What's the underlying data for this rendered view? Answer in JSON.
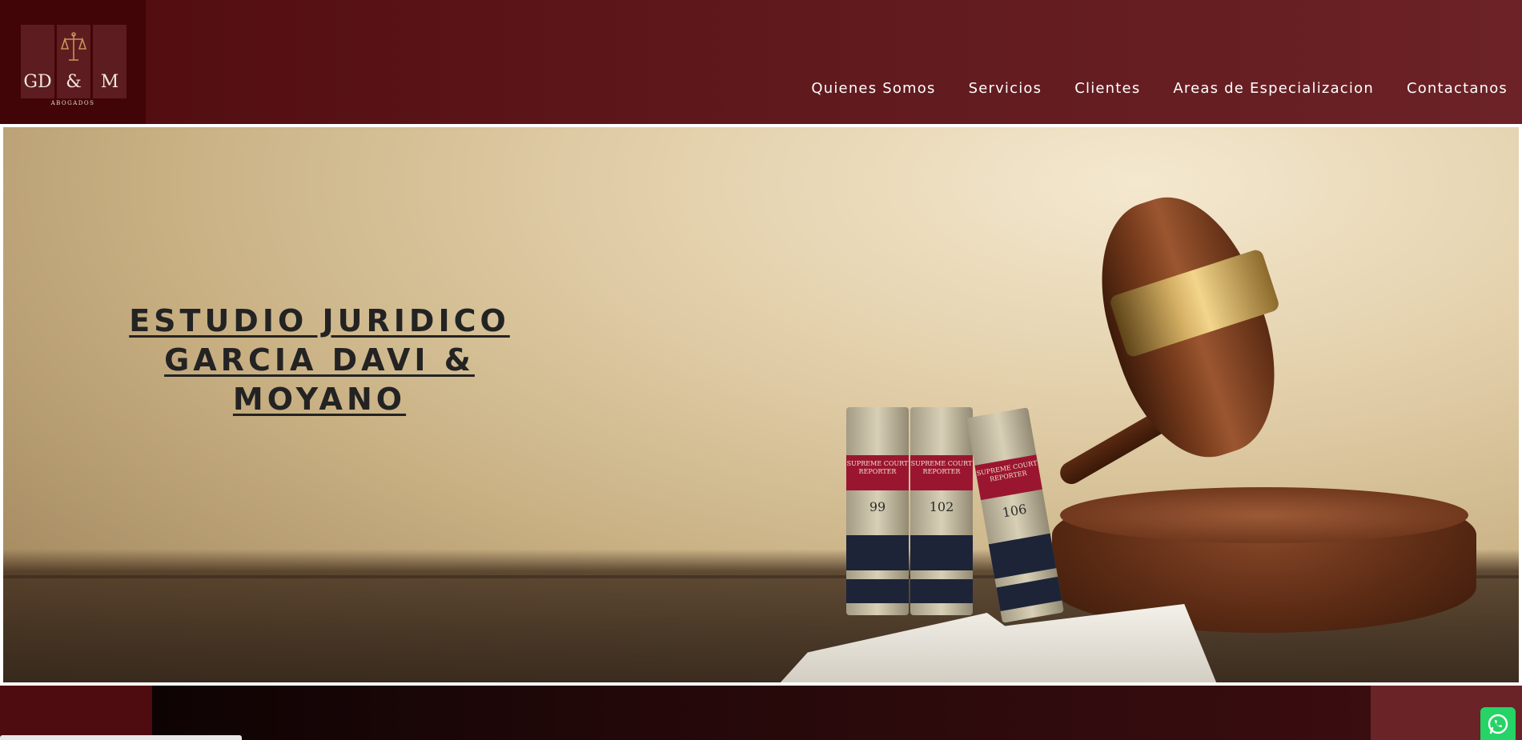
{
  "logo": {
    "letters": [
      "GD",
      "&",
      "M"
    ],
    "subtitle": "ABOGADOS"
  },
  "nav": {
    "items": [
      {
        "label": "Quienes Somos"
      },
      {
        "label": "Servicios"
      },
      {
        "label": "Clientes"
      },
      {
        "label": "Areas de Especializacion"
      },
      {
        "label": "Contactanos"
      }
    ]
  },
  "hero": {
    "title_line1": "ESTUDIO JURIDICO",
    "title_line2": "GARCIA DAVI &",
    "title_line3": "MOYANO",
    "books": [
      {
        "number": "99",
        "label": "SUPREME COURT REPORTER"
      },
      {
        "number": "102",
        "label": "SUPREME COURT REPORTER"
      },
      {
        "number": "106",
        "label": "SUPREME COURT REPORTER"
      }
    ]
  },
  "colors": {
    "header_bg": "#5e181c",
    "logo_bg": "#420507",
    "whatsapp": "#25d366"
  },
  "icons": {
    "logo_icon": "scales-of-justice-icon",
    "chat_icon": "whatsapp-icon"
  }
}
